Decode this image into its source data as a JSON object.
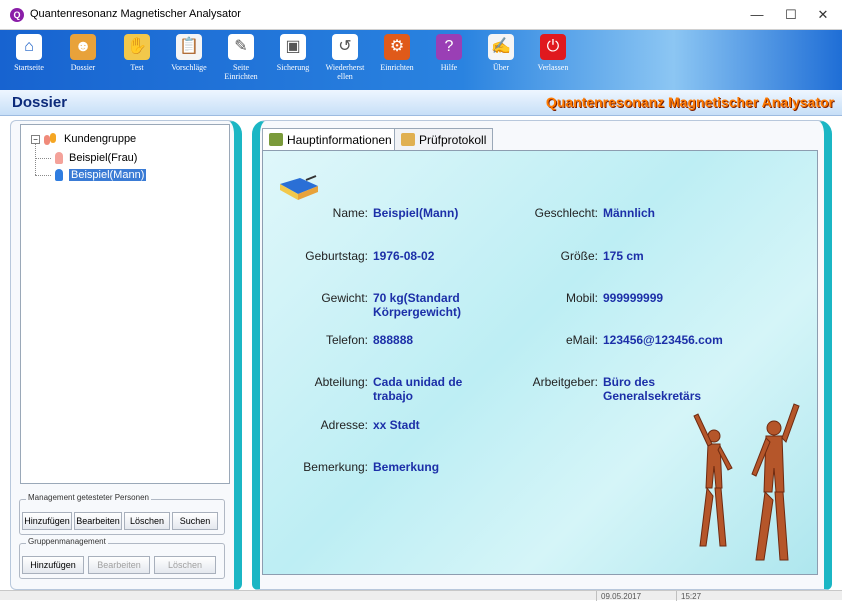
{
  "window": {
    "title": "Quantenresonanz Magnetischer Analysator",
    "minimize": "—",
    "maximize": "☐",
    "close": "✕"
  },
  "toolbar": {
    "items": [
      {
        "label": "Startseite",
        "icon": "home-icon",
        "color": "#ffffff"
      },
      {
        "label": "Dossier",
        "icon": "people-icon",
        "color": "#e8a23a"
      },
      {
        "label": "Test",
        "icon": "hand-icon",
        "color": "#f2c84b"
      },
      {
        "label": "Vorschläge",
        "icon": "clipboard-icon",
        "color": "#f5f5f5"
      },
      {
        "label": "Seite\nEinrichten",
        "icon": "settings-page-icon",
        "color": "#ffffff"
      },
      {
        "label": "Sicherung",
        "icon": "backup-icon",
        "color": "#ffffff"
      },
      {
        "label": "Wiederherst\nellen",
        "icon": "restore-icon",
        "color": "#ffffff"
      },
      {
        "label": "Einrichten",
        "icon": "gears-icon",
        "color": "#e05a1a"
      },
      {
        "label": "Hilfe",
        "icon": "help-book-icon",
        "color": "#9a3fb5"
      },
      {
        "label": "Über",
        "icon": "about-icon",
        "color": "#f5f5f5"
      },
      {
        "label": "Verlassen",
        "icon": "power-icon",
        "color": "#e0191e"
      }
    ]
  },
  "header": {
    "section": "Dossier",
    "brand": "Quantenresonanz Magnetischer Analysator"
  },
  "tree": {
    "root": "Kundengruppe",
    "toggle": "−",
    "children": [
      "Beispiel(Frau)",
      "Beispiel(Mann)"
    ]
  },
  "person_management": {
    "title": "Management getesteter Personen",
    "buttons": [
      "Hinzufügen",
      "Bearbeiten",
      "Löschen",
      "Suchen"
    ]
  },
  "group_management": {
    "title": "Gruppenmanagement",
    "buttons": [
      "Hinzufügen",
      "Bearbeiten",
      "Löschen"
    ]
  },
  "tabs": [
    "Hauptinformationen",
    "Prüfprotokoll"
  ],
  "fields": {
    "name": {
      "label": "Name:",
      "value": "Beispiel(Mann)"
    },
    "geschlecht": {
      "label": "Geschlecht:",
      "value": "Männlich"
    },
    "geburtstag": {
      "label": "Geburtstag:",
      "value": "1976-08-02"
    },
    "groesse": {
      "label": "Größe:",
      "value": "175 cm"
    },
    "gewicht": {
      "label": "Gewicht:",
      "value": "70 kg(Standard Körpergewicht)"
    },
    "mobil": {
      "label": "Mobil:",
      "value": "999999999"
    },
    "telefon": {
      "label": "Telefon:",
      "value": "888888"
    },
    "email": {
      "label": "eMail:",
      "value": "123456@123456.com"
    },
    "abteilung": {
      "label": "Abteilung:",
      "value": "Cada unidad de trabajo"
    },
    "arbeitgeber": {
      "label": "Arbeitgeber:",
      "value": "Büro des Generalsekretärs"
    },
    "adresse": {
      "label": "Adresse:",
      "value": "xx Stadt"
    },
    "bemerkung": {
      "label": "Bemerkung:",
      "value": "Bemerkung"
    }
  },
  "status": {
    "date": "09.05.2017",
    "time": "15:27"
  },
  "colors": {
    "toolbar": "#1f6ed6",
    "accent_teal": "#1bb6c4",
    "value_text": "#1c2fa8",
    "brand_orange": "#ff7a00"
  }
}
